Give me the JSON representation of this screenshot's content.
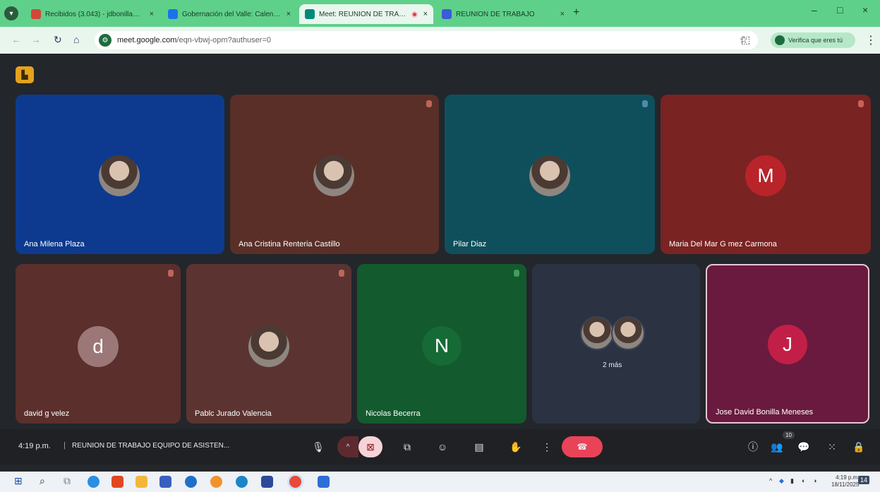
{
  "browser": {
    "tabs": [
      {
        "title": "Recibidos (3.043) - jdbonilla@...",
        "favicon_color": "#d44638",
        "active": false
      },
      {
        "title": "Gobernación del Valle: Calend...",
        "favicon_color": "#1a73e8",
        "active": false
      },
      {
        "title": "Meet: REUNION DE TRABA...",
        "favicon_color": "#00897b",
        "active": true
      },
      {
        "title": "REUNION DE TRABAJO",
        "favicon_color": "#3c5bd6",
        "active": false
      }
    ],
    "close_glyph": "×",
    "new_tab_glyph": "+",
    "minimize_glyph": "–",
    "maximize_glyph": "□",
    "close_window_glyph": "×",
    "url_host": "meet.google.com",
    "url_path": "/eqn-vbwj-opm?authuser=0",
    "profile_chip": "Verifica que eres tú",
    "accent": "#5fd08a"
  },
  "meet": {
    "participants_top": [
      {
        "name": "Ana Milena Plaza",
        "color": "#0d3a8e",
        "avatar": "photo"
      },
      {
        "name": "Ana Cristina Renteria Castillo",
        "color": "#5a2f28",
        "avatar": "photo"
      },
      {
        "name": "Pilar Diaz",
        "color": "#0f4f5c",
        "avatar": "photo"
      },
      {
        "name": "Maria Del Mar G mez Carmona",
        "color": "#7a2323",
        "avatar": "letter",
        "letter": "M",
        "avatar_color": "#b8242a"
      }
    ],
    "participants_bottom": [
      {
        "name": "david g velez",
        "color": "#5a2f2c",
        "avatar": "letter",
        "letter": "d",
        "avatar_color": "#9c7777"
      },
      {
        "name": "Pablc Jurado Valencia",
        "color": "#5b3431",
        "avatar": "photo"
      },
      {
        "name": "Nicolas Becerra",
        "color": "#135a2e",
        "avatar": "letter",
        "letter": "N",
        "avatar_color": "#166a35"
      },
      {
        "name": "",
        "color": "#2b3242",
        "avatar": "group",
        "more_label": "2 más"
      },
      {
        "name": "Jose David Bonilla Meneses",
        "color": "#6a1a3e",
        "avatar": "letter",
        "letter": "J",
        "avatar_color": "#c21f48",
        "highlight": true
      }
    ]
  },
  "controls": {
    "time": "4:19 p.m.",
    "separator": "|",
    "meeting_title": "REUNION DE TRABAJO EQUIPO DE ASISTEN...",
    "people_count": "10",
    "icons": {
      "mic": "🎙",
      "chevron_up": "^",
      "camera_off": "⊠",
      "present": "⧉",
      "emoji": "☺",
      "captions": "▤",
      "hand": "✋",
      "more": "⋮",
      "hangup": "☎",
      "info": "ⓘ",
      "people": "👥",
      "chat": "💬",
      "activities": "⁙",
      "lock": "🔒"
    }
  },
  "taskbar": {
    "tray_date_time": "4:19 p.m.\n18/11/2025",
    "notification_count": "14"
  }
}
